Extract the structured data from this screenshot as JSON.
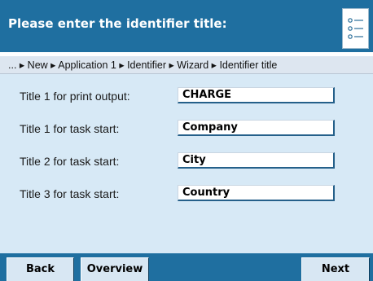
{
  "header": {
    "title": "Please enter the identifier title:",
    "menu_icon": "list-icon"
  },
  "breadcrumb": {
    "ellipsis": "...",
    "separator": "▸",
    "items": [
      "New",
      "Application 1",
      "Identifier",
      "Wizard",
      "Identifier title"
    ]
  },
  "rows": [
    {
      "label": "Title 1 for print output:",
      "value": "CHARGE"
    },
    {
      "label": "Title 1 for task start:",
      "value": "Company"
    },
    {
      "label": "Title 2 for task start:",
      "value": "City"
    },
    {
      "label": "Title 3 for task start:",
      "value": "Country"
    }
  ],
  "footer": {
    "back_label": "Back",
    "overview_label": "Overview",
    "next_label": "Next"
  },
  "colors": {
    "header_bg": "#1f6fa0",
    "content_bg": "#d7e9f6",
    "breadcrumb_bg": "#dde6f0",
    "field_border": "#25608a"
  }
}
